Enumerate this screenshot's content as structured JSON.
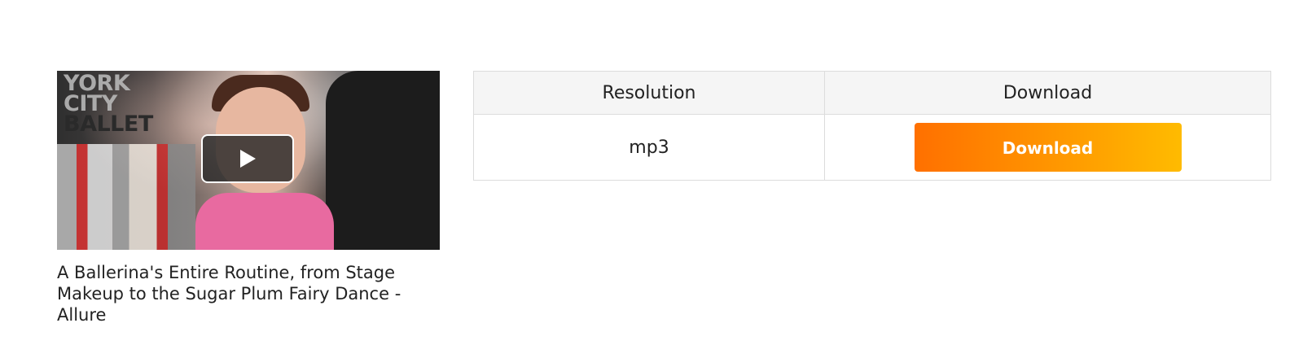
{
  "video": {
    "title": "A Ballerina's Entire Routine, from Stage Makeup to the Sugar Plum Fairy Dance - Allure",
    "thumbnail_logo": [
      "YORK",
      "CITY",
      "BALLET"
    ]
  },
  "table": {
    "headers": [
      "Resolution",
      "Download"
    ],
    "rows": [
      {
        "resolution": "mp3",
        "button_label": "Download"
      }
    ]
  },
  "colors": {
    "download_gradient_start": "#ff7000",
    "download_gradient_end": "#ffbb00",
    "header_bg": "#f5f5f5",
    "border": "#dcdcdc"
  },
  "icons": {
    "play": "play-icon"
  }
}
